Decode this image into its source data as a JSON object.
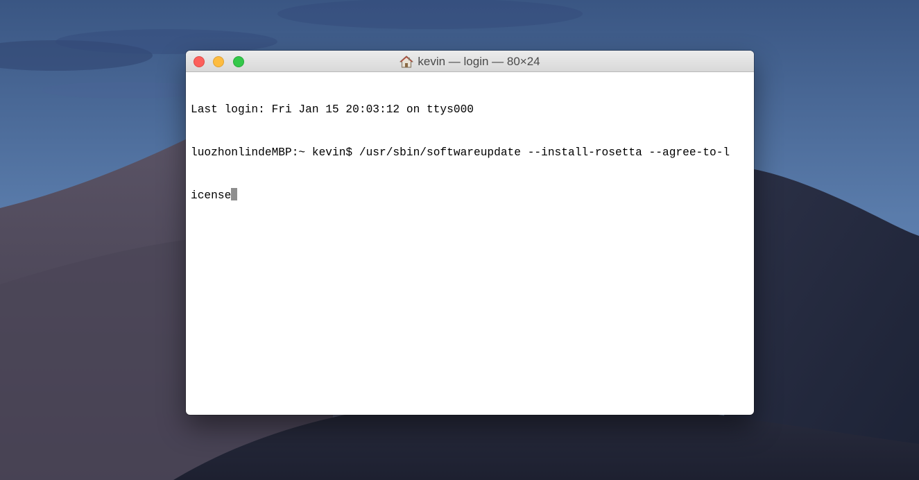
{
  "window": {
    "title": "kevin — login — 80×24",
    "title_icon": "home-icon"
  },
  "terminal": {
    "lines": [
      "Last login: Fri Jan 15 20:03:12 on ttys000",
      "luozhonlindeMBP:~ kevin$ /usr/sbin/softwareupdate --install-rosetta --agree-to-l",
      "icense"
    ],
    "cursor_color": "#8e8e8e"
  },
  "colors": {
    "close": "#fc605c",
    "minimize": "#fdbc40",
    "zoom": "#34c84a"
  }
}
